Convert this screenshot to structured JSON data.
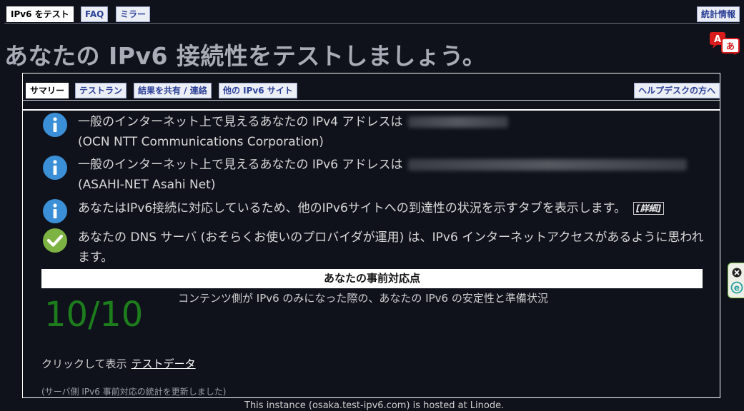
{
  "nav": {
    "tab_test": "IPv6 をテスト",
    "tab_faq": "FAQ",
    "tab_mirror": "ミラー",
    "tab_stats": "統計情報"
  },
  "title": "あなたの IPv6 接続性をテストしましょう。",
  "language_icon": {
    "icon": "language-translate-icon",
    "latin": "A",
    "kana": "あ",
    "color": "#d81b1b"
  },
  "subtabs": {
    "summary": "サマリー",
    "test_run": "テストラン",
    "share": "結果を共有 / 連絡",
    "other_sites": "他の IPv6 サイト",
    "helpdesk": "ヘルプデスクの方へ"
  },
  "status": [
    {
      "icon": "info-icon",
      "text": "一般のインターネット上で見えるあなたの IPv4 アドレスは",
      "detail": "(OCN NTT Communications Corporation)"
    },
    {
      "icon": "info-icon",
      "text": "一般のインターネット上で見えるあなたの IPv6 アドレスは",
      "detail": "(ASAHI-NET Asahi Net)"
    },
    {
      "icon": "info-icon",
      "text": "あなたはIPv6接続に対応しているため、他のIPv6サイトへの到達性の状況を示すタブを表示します。",
      "link": "[詳細]"
    },
    {
      "icon": "check-icon",
      "text": "あなたの DNS サーバ (おそらくお使いのプロバイダが運用) は、IPv6 インターネットアクセスがあるように思われます。"
    }
  ],
  "readiness": {
    "title": "あなたの事前対応点",
    "score": "10/10",
    "description": "コンテンツ側が IPv6 のみになった際の、あなたの IPv6 の安定性と準備状況"
  },
  "click_show": "クリックして表示",
  "test_data_link": "テストデータ",
  "stats_note": "(サーバ側 IPv6 事前対応の統計を更新しました)",
  "footer": "This instance (osaka.test-ipv6.com) is hosted at Linode.",
  "colors": {
    "accent_red": "#d81b1b",
    "info_blue": "#3b8fd6",
    "check_green": "#7cb342",
    "score_green": "#1d7d1d"
  }
}
